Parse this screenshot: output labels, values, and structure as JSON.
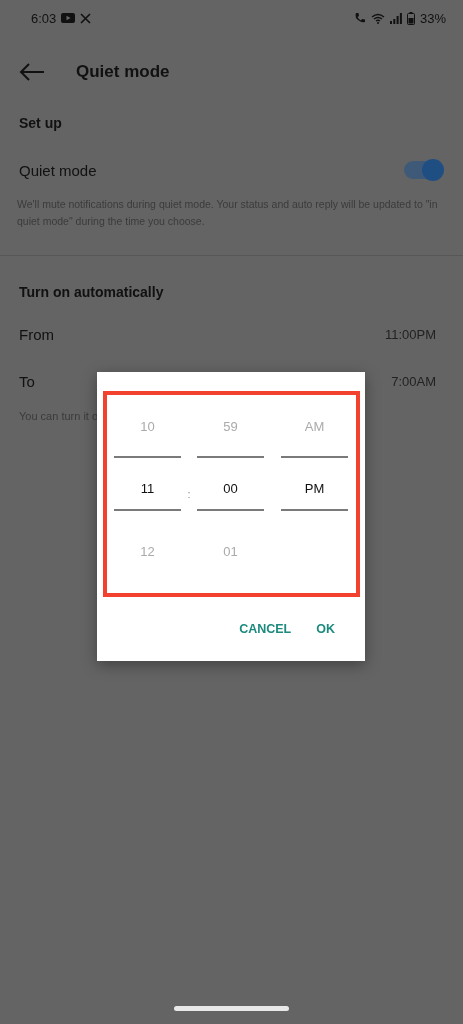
{
  "status_bar": {
    "time": "6:03",
    "battery": "33%"
  },
  "header": {
    "title": "Quiet mode"
  },
  "setup": {
    "heading": "Set up",
    "toggle": {
      "label": "Quiet mode",
      "on": true
    },
    "description": "We'll mute notifications during quiet mode. Your status and auto reply will be updated to \"in quiet mode\" during the time you choose."
  },
  "auto": {
    "heading": "Turn on automatically",
    "rows": [
      {
        "label": "From",
        "value": "11:00PM"
      },
      {
        "label": "To",
        "value": "7:00AM"
      }
    ],
    "note": "You can turn it o"
  },
  "dialog": {
    "separator": ":",
    "columns": [
      {
        "items": [
          {
            "text": "10",
            "selected": false
          },
          {
            "text": "11",
            "selected": true
          },
          {
            "text": "12",
            "selected": false
          }
        ]
      },
      {
        "items": [
          {
            "text": "59",
            "selected": false
          },
          {
            "text": "00",
            "selected": true
          },
          {
            "text": "01",
            "selected": false
          }
        ]
      },
      {
        "items": [
          {
            "text": "AM",
            "selected": false
          },
          {
            "text": "PM",
            "selected": true
          }
        ]
      }
    ],
    "buttons": [
      "CANCEL",
      "OK"
    ]
  }
}
